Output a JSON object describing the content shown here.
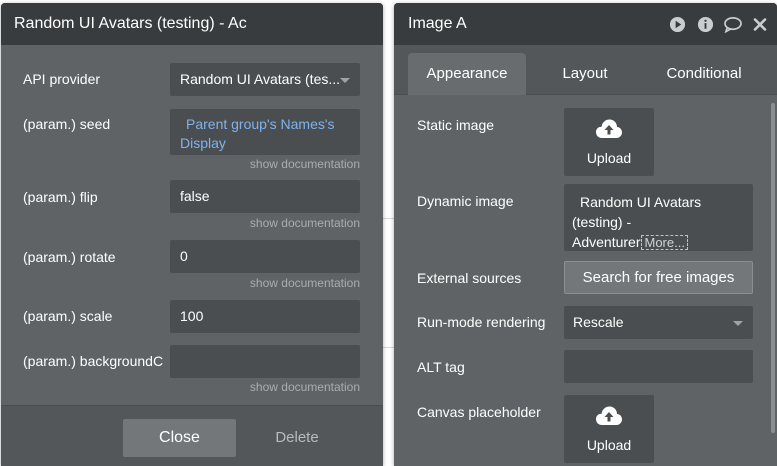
{
  "left_panel": {
    "title": "Random UI Avatars (testing) - Ac",
    "rows": [
      {
        "label": "API provider",
        "value": "Random UI Avatars (tes...",
        "type": "dropdown"
      },
      {
        "label": "(param.) seed",
        "value": "Parent group's Names's Display",
        "type": "dynamic",
        "doc": "show documentation"
      },
      {
        "label": "(param.) flip",
        "value": "false",
        "type": "text",
        "doc": "show documentation"
      },
      {
        "label": "(param.) rotate",
        "value": "0",
        "type": "text",
        "doc": "show documentation"
      },
      {
        "label": "(param.) scale",
        "value": "100",
        "type": "text",
        "doc": "show documentation"
      },
      {
        "label": "(param.) backgroundC",
        "value": "",
        "type": "text",
        "doc": "show documentation"
      }
    ],
    "close_label": "Close",
    "delete_label": "Delete"
  },
  "right_panel": {
    "title": "Image A",
    "icons": [
      "play-icon",
      "info-icon",
      "comment-icon",
      "close-icon"
    ],
    "tabs": [
      "Appearance",
      "Layout",
      "Conditional"
    ],
    "active_tab": "Appearance",
    "static_image_label": "Static image",
    "upload_label": "Upload",
    "dynamic_image_label": "Dynamic image",
    "dynamic_image_line1": "Random UI Avatars",
    "dynamic_image_line2": "(testing) -",
    "dynamic_image_line3": "Adventurer",
    "more_label": "More...",
    "external_sources_label": "External sources",
    "search_button": "Search for free images",
    "run_mode_label": "Run-mode rendering",
    "run_mode_value": "Rescale",
    "alt_tag_label": "ALT tag",
    "alt_tag_value": "",
    "canvas_placeholder_label": "Canvas placeholder",
    "canvas_upload_label": "Upload"
  },
  "colors": {
    "panel_bg": "#5f6366",
    "header_bg": "#383c3f",
    "field_bg": "#4a4e51",
    "dynamic_text": "#7fb3ec",
    "button_bg": "#73777a"
  }
}
